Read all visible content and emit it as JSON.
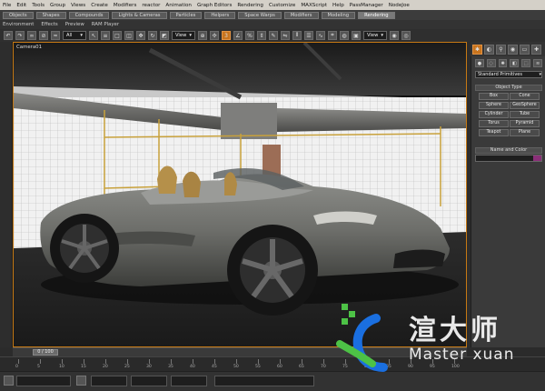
{
  "menubar": {
    "items": [
      "File",
      "Edit",
      "Tools",
      "Group",
      "Views",
      "Create",
      "Modifiers",
      "reactor",
      "Animation",
      "Graph Editors",
      "Rendering",
      "Customize",
      "MAXScript",
      "Help",
      "PassManager",
      "NodeJoe"
    ]
  },
  "tabs": {
    "items": [
      "Objects",
      "Shapes",
      "Compounds",
      "Lights & Cameras",
      "Particles",
      "Helpers",
      "Space Warps",
      "Modifiers",
      "Modeling",
      "Rendering"
    ]
  },
  "toolbar2": {
    "items": [
      "Environment",
      "Effects",
      "Preview",
      "RAM Player"
    ]
  },
  "toolbar3": {
    "filter_value": "All",
    "refcoord_value": "View",
    "selset_value": "View"
  },
  "viewport": {
    "label": "Camera01"
  },
  "command_panel": {
    "category_dropdown": "Standard Primitives",
    "object_type_header": "Object Type",
    "buttons": [
      "Box",
      "Cone",
      "Sphere",
      "GeoSphere",
      "Cylinder",
      "Tube",
      "Torus",
      "Pyramid",
      "Teapot",
      "Plane"
    ],
    "name_color_header": "Name and Color",
    "object_color": "#8a2f78"
  },
  "timeline": {
    "frame_counter": "0 / 100"
  },
  "track": {
    "tick_labels": [
      "0",
      "5",
      "10",
      "15",
      "20",
      "25",
      "30",
      "35",
      "40",
      "45",
      "50",
      "55",
      "60",
      "65",
      "70",
      "75",
      "80",
      "85",
      "90",
      "95",
      "100"
    ]
  },
  "watermark": {
    "brand_text": "渲大师",
    "brand_sub": "Master xuan",
    "colors": {
      "green": "#4dc246",
      "blue": "#1a6fe0"
    }
  },
  "colors": {
    "accent_orange": "#c77a14",
    "ui_gray": "#3a3a3a"
  }
}
